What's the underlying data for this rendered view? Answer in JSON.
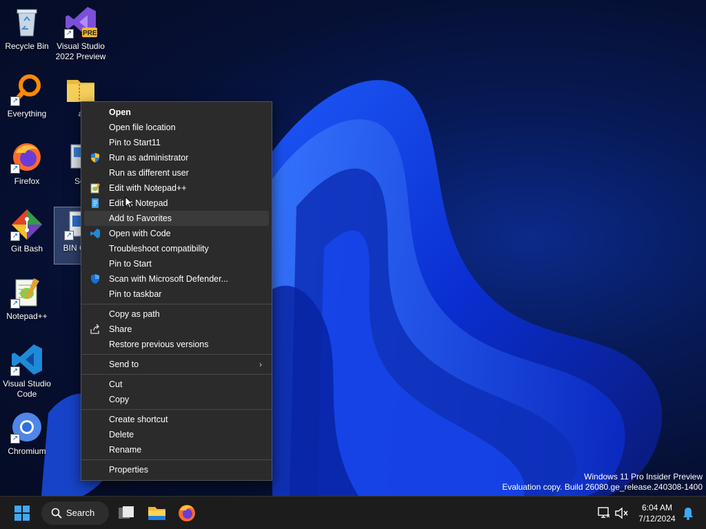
{
  "desktop": {
    "icons": [
      {
        "label": "Recycle Bin"
      },
      {
        "label": "Visual Studio 2022 Preview",
        "badge": "PRE"
      },
      {
        "label": "Everything"
      },
      {
        "label": "a"
      },
      {
        "label": "Firefox"
      },
      {
        "label": "Set"
      },
      {
        "label": "Git Bash"
      },
      {
        "label": "BIN CHIL"
      },
      {
        "label": "Notepad++"
      },
      {
        "label": "Visual Studio Code"
      },
      {
        "label": "Chromium"
      }
    ]
  },
  "context_menu": {
    "items": [
      {
        "label": "Open"
      },
      {
        "label": "Open file location"
      },
      {
        "label": "Pin to Start11"
      },
      {
        "label": "Run as administrator",
        "icon": "shield-icon"
      },
      {
        "label": "Run as different user"
      },
      {
        "label": "Edit with Notepad++",
        "icon": "notepadpp-icon"
      },
      {
        "label": "Edit in Notepad",
        "icon": "notepad-icon"
      },
      {
        "label": "Add to Favorites"
      },
      {
        "label": "Open with Code",
        "icon": "vscode-icon"
      },
      {
        "label": "Troubleshoot compatibility"
      },
      {
        "label": "Pin to Start"
      },
      {
        "label": "Scan with Microsoft Defender...",
        "icon": "defender-icon"
      },
      {
        "label": "Pin to taskbar"
      },
      {
        "label": "Copy as path"
      },
      {
        "label": "Share",
        "icon": "share-icon"
      },
      {
        "label": "Restore previous versions"
      },
      {
        "label": "Send to"
      },
      {
        "label": "Cut"
      },
      {
        "label": "Copy"
      },
      {
        "label": "Create shortcut"
      },
      {
        "label": "Delete"
      },
      {
        "label": "Rename"
      },
      {
        "label": "Properties"
      }
    ]
  },
  "watermark": {
    "line1": "Windows 11 Pro Insider Preview",
    "line2": "Evaluation copy. Build 26080.ge_release.240308-1400"
  },
  "taskbar": {
    "search_label": "Search",
    "time": "6:04 AM",
    "date": "7/12/2024"
  },
  "colors": {
    "accent": "#0078d4",
    "menu_bg": "#2b2b2b",
    "taskbar_bg": "#1c1c1c"
  }
}
